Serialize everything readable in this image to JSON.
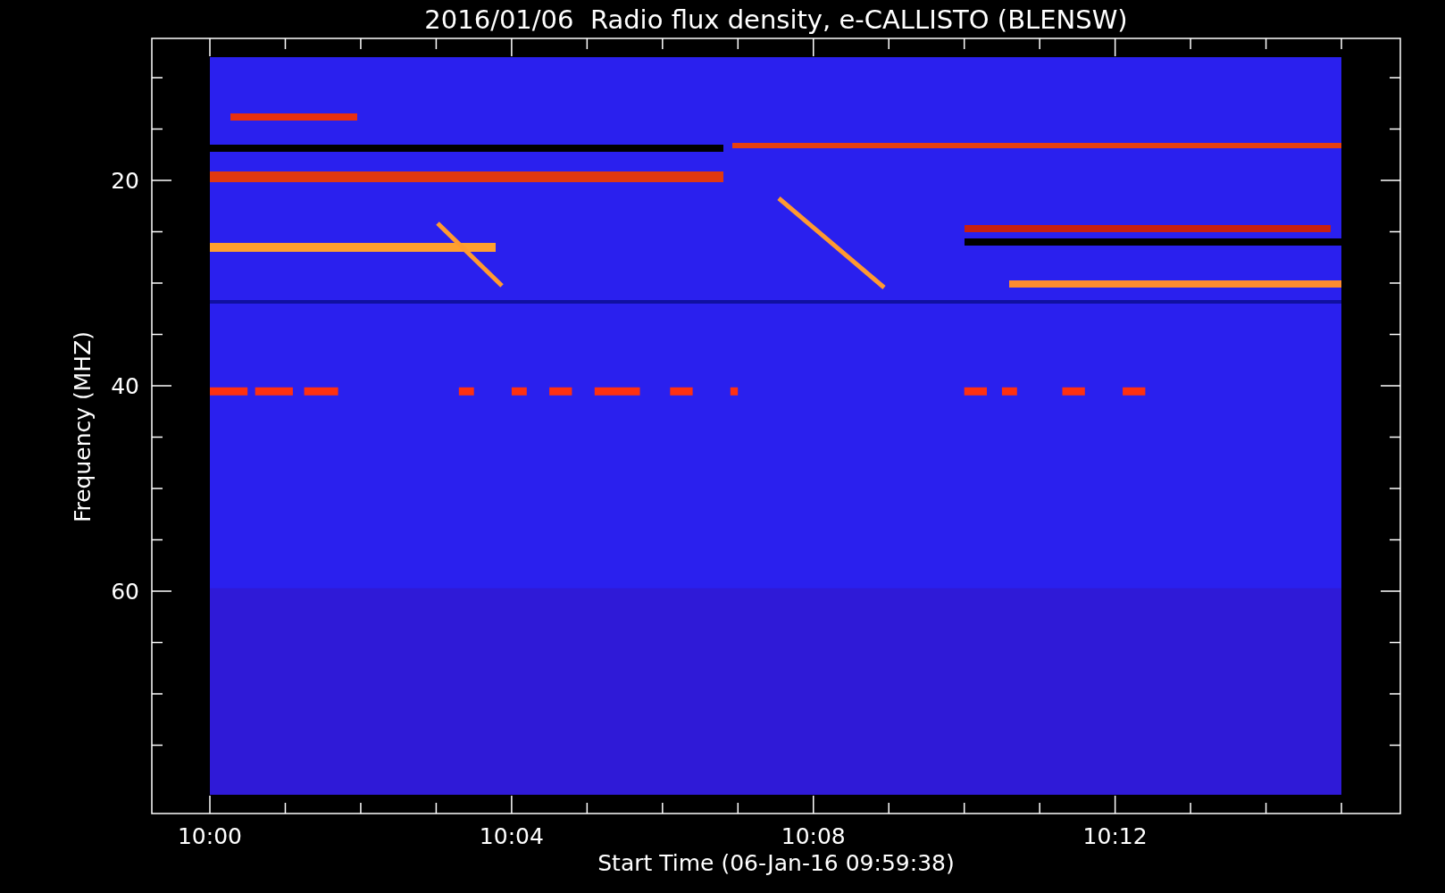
{
  "plot": {
    "title": "2016/01/06  Radio flux density, e-CALLISTO (BLENSW)",
    "xlabel": "Start Time (06-Jan-16 09:59:38)",
    "ylabel": "Frequency (MHZ)",
    "xtick_labels": [
      "10:00",
      "10:04",
      "10:08",
      "10:12"
    ],
    "ytick_labels": [
      "20",
      "40",
      "60"
    ]
  }
}
